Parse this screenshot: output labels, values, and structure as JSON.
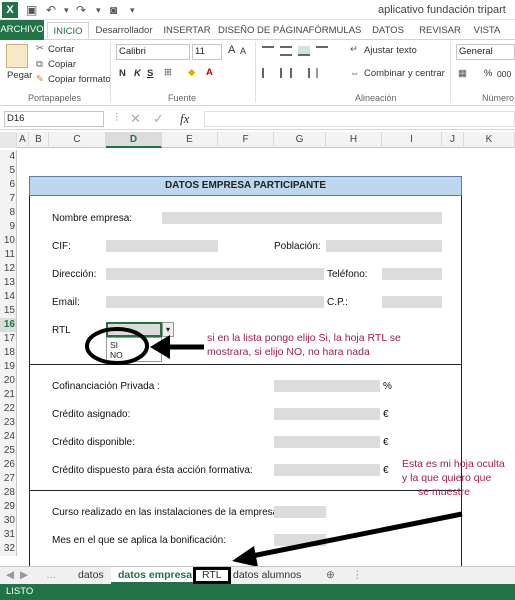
{
  "app": {
    "icon_letter": "X",
    "window_title": "aplicativo fundación tripart"
  },
  "ribbon_tabs": [
    "ARCHIVO",
    "INICIO",
    "Desarrollador",
    "INSERTAR",
    "DISEÑO DE PÁGINA",
    "FÓRMULAS",
    "DATOS",
    "REVISAR",
    "VISTA"
  ],
  "clipboard": {
    "paste": "Pegar",
    "cut": "Cortar",
    "copy": "Copiar",
    "copy_format": "Copiar formato",
    "group": "Portapapeles"
  },
  "font": {
    "name": "Calibri",
    "size": "11",
    "bold": "N",
    "italic": "K",
    "underline": "S",
    "group": "Fuente"
  },
  "alignment": {
    "wrap": "Ajustar texto",
    "merge": "Combinar y centrar",
    "group": "Alineación"
  },
  "number": {
    "format": "General",
    "percent": "%",
    "thousands": "000",
    "group": "Número"
  },
  "formula_bar": {
    "name_box": "D16",
    "fx": "fx",
    "value": ""
  },
  "columns": [
    "A",
    "B",
    "C",
    "D",
    "E",
    "F",
    "G",
    "H",
    "I",
    "J",
    "K"
  ],
  "rows": [
    "4",
    "5",
    "6",
    "7",
    "8",
    "9",
    "10",
    "11",
    "12",
    "13",
    "14",
    "15",
    "16",
    "17",
    "18",
    "19",
    "20",
    "21",
    "22",
    "23",
    "24",
    "25",
    "26",
    "27",
    "28",
    "29",
    "30",
    "31",
    "32"
  ],
  "sheet": {
    "header": "DATOS EMPRESA PARTICIPANTE",
    "nombre": "Nombre empresa:",
    "cif": "CIF:",
    "poblacion": "Población:",
    "direccion": "Dirección:",
    "telefono": "Teléfono:",
    "email": "Email:",
    "cp": "C.P.:",
    "rtl": "RTL",
    "dropdown_si": "SI",
    "dropdown_no": "NO",
    "cofin": "Cofinanciación Privada :",
    "percent": "%",
    "cred_asig": "Crédito asignado:",
    "cred_disp": "Crédito disponible:",
    "cred_dispuesto": "Crédito dispuesto para ésta acción formativa:",
    "euro": "€",
    "curso": "Curso realizado en las instalaciones de la empresa:",
    "mes": "Mes en el que se aplica la bonificación:"
  },
  "notes": {
    "rtl_note": [
      "si en la lista pongo elijo Si, la hoja RTL se",
      "mostrara, si elijo NO, no hara nada"
    ],
    "hidden_note": [
      "Esta es mi hoja oculta",
      "y la que quiero que",
      "se muestre"
    ]
  },
  "sheet_tabs": [
    "datos",
    "datos empresa",
    "RTL",
    "datos alumnos"
  ],
  "status": "LISTO",
  "colors": {
    "excel_green": "#217346",
    "header_blue": "#bdd7ee",
    "field_gray": "#dcdcdc",
    "note_red": "#a0214a"
  }
}
